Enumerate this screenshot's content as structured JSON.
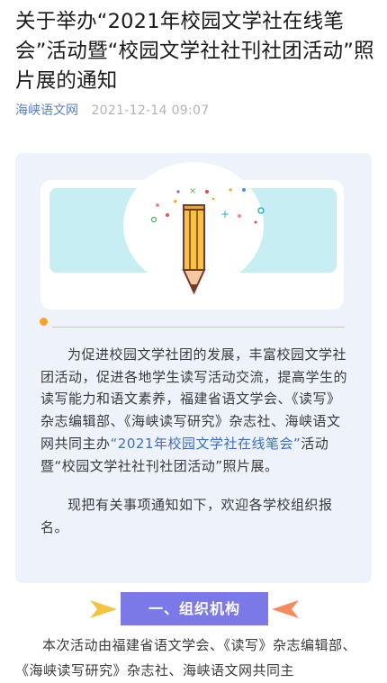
{
  "article": {
    "title": "关于举办“2021年校园文学社在线笔会”活动暨“校园文学社社刊社团活动”照片展的通知",
    "source": "海峡语文网",
    "date": "2021-12-14 09:07"
  },
  "intro": {
    "p1_before": "为促进校园文学社团的发展，丰富校园文学社团活动，促进各地学生读写活动交流，提高学生的读写能力和语文素养，福建省语文学会、《读写》杂志编辑部、《海峡读写研究》杂志社、海峡语文网共同主办",
    "p1_highlight": "“2021年校园文学社在线笔会”",
    "p1_after": "活动暨“校园文学社社刊社团活动”照片展。",
    "p2": "现把有关事项通知如下，欢迎各学校组织报名。"
  },
  "section1": {
    "heading": "一、组织机构",
    "text": "本次活动由福建省语文学会、《读写》杂志编辑部、《海峡读写研究》杂志社、海峡语文网共同主"
  },
  "colors": {
    "accent_link": "#3b6fc2",
    "section_bg": "#7b78e8",
    "card_bg": "#eef2fb",
    "banner_teal": "#c7eef2",
    "pencil": "#f5c242"
  }
}
